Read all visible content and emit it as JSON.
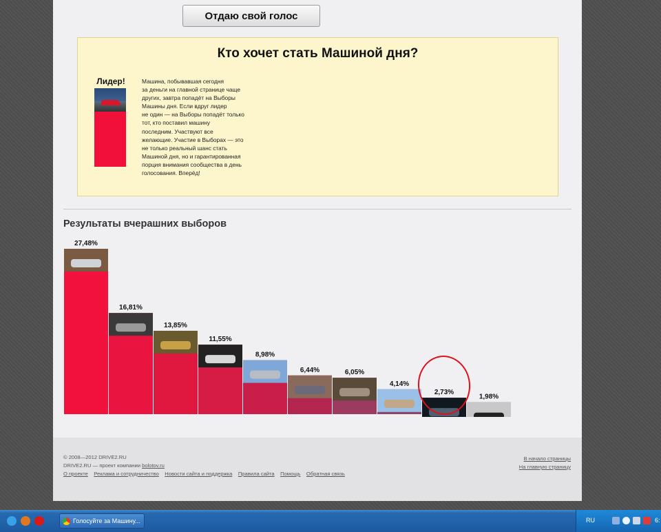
{
  "vote_button": "Отдаю свой голос",
  "promo": {
    "title": "Кто хочет стать Машиной дня?",
    "leader_label": "Лидер!",
    "lines": [
      "Машина, побывавшая сегодня",
      "за деньги на главной странице чаще",
      "других, завтра попадёт на Выборы",
      "Машины дня. Если вдруг лидер",
      "не один — на Выборы попадёт только",
      "тот, кто поставил машину",
      "последним. Участвуют все",
      "желающие. Участие в Выборах — это",
      "не только реальный шанс стать",
      "Машиной дня, но и гарантированная",
      "порция внимания сообщества в день",
      "голосования. Вперёд!"
    ]
  },
  "results_title": "Результаты вчерашних выборов",
  "chart_data": {
    "type": "bar",
    "values": [
      27.48,
      16.81,
      13.85,
      11.55,
      8.98,
      6.44,
      6.05,
      4.14,
      2.73,
      1.98
    ],
    "labels": [
      "27,48%",
      "16,81%",
      "13,85%",
      "11,55%",
      "8,98%",
      "6,44%",
      "6,05%",
      "4,14%",
      "2,73%",
      "1,98%"
    ],
    "ylim": [
      0,
      27.48
    ],
    "colors": [
      "#f2103c",
      "#ea1440",
      "#e0183f",
      "#d61b44",
      "#c91e49",
      "#b3264f",
      "#9c3a60",
      "#8b456a",
      "#744f77",
      "#5a5d84"
    ]
  },
  "footer": {
    "copyright": "© 2008—2012 DRIVE2.RU",
    "company_prefix": "DRIVE2.RU — проект компании",
    "company_link": "bolotov.ru",
    "links": [
      "О проекте",
      "Реклама и сотрудничество",
      "Новости сайта и поддержка",
      "Правила сайта",
      "Помощь",
      "Обратная связь"
    ],
    "top_link": "В начало страницы",
    "home_link": "На главную страницу"
  },
  "taskbar": {
    "window_title": "Голосуйте за Машину...",
    "language": "RU",
    "clock": "6:"
  }
}
